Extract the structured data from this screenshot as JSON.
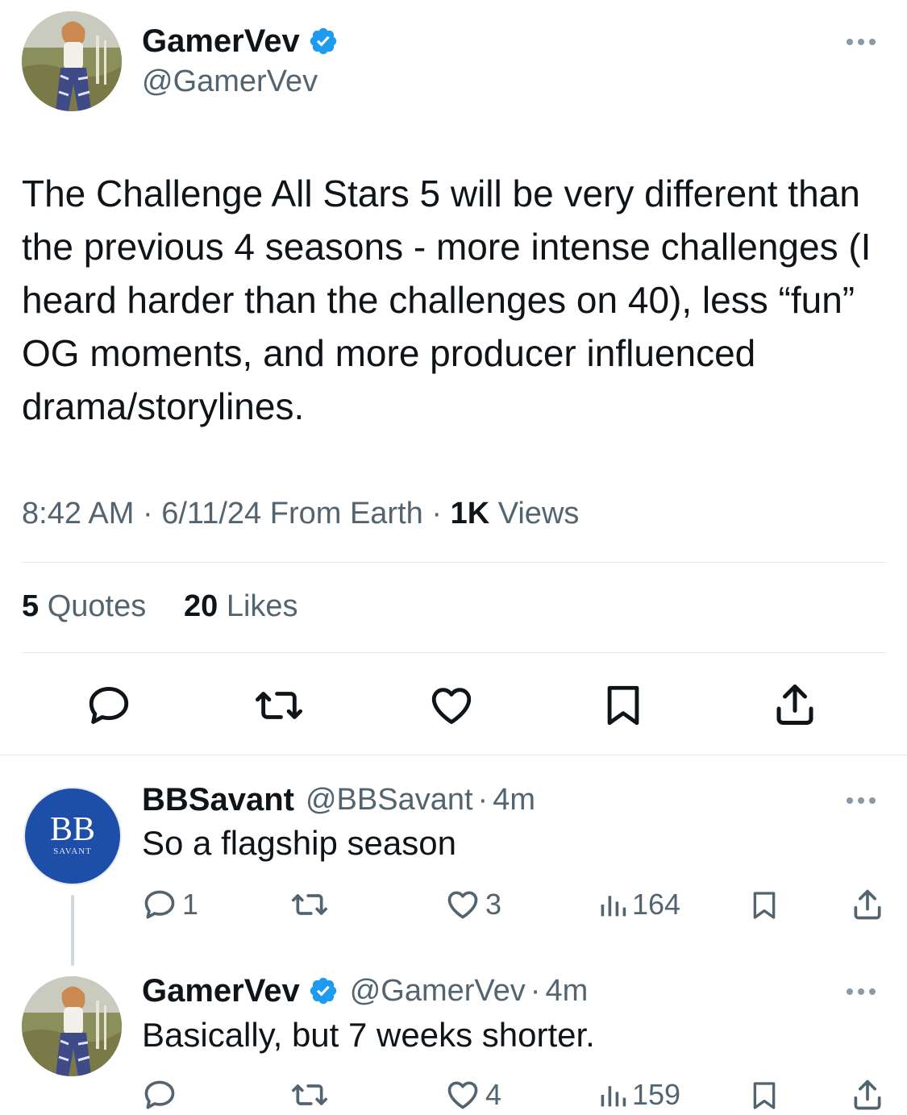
{
  "main_tweet": {
    "display_name": "GamerVev",
    "handle": "@GamerVev",
    "text": "The Challenge All Stars 5 will be very different than the previous 4 seasons - more intense challenges (I heard harder than the challenges on 40), less “fun” OG moments, and more producer influenced drama/storylines.",
    "time": "8:42 AM",
    "date": "6/11/24",
    "source": "From Earth",
    "views_count": "1K",
    "views_label": "Views",
    "quotes_count": "5",
    "quotes_label": "Quotes",
    "likes_count": "20",
    "likes_label": "Likes",
    "sep": "·"
  },
  "replies": [
    {
      "display_name": "BBSavant",
      "handle": "@BBSavant",
      "time": "4m",
      "text": "So a flagship season",
      "reply_count": "1",
      "retweet_count": "",
      "like_count": "3",
      "view_count": "164",
      "avatar_text": "BB",
      "avatar_subtext": "SAVANT"
    },
    {
      "display_name": "GamerVev",
      "handle": "@GamerVev",
      "time": "4m",
      "text": "Basically, but 7 weeks shorter.",
      "reply_count": "",
      "retweet_count": "",
      "like_count": "4",
      "view_count": "159"
    }
  ],
  "colors": {
    "verified": "#1d9bf0",
    "muted": "#536471",
    "text": "#0f1419",
    "bbsavant_bg": "#1e4fa8"
  }
}
